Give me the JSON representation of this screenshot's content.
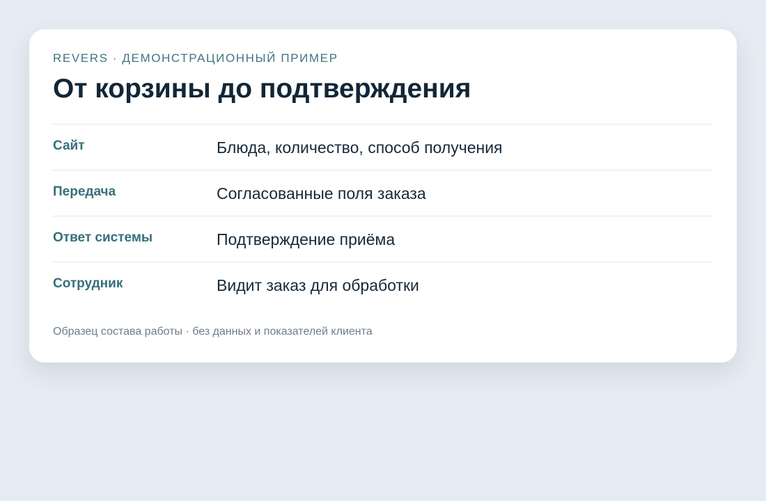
{
  "card": {
    "eyebrow": "REVERS · ДЕМОНСТРАЦИОННЫЙ ПРИМЕР",
    "title": "От корзины до подтверждения",
    "rows": [
      {
        "label": "Сайт",
        "value": "Блюда, количество, способ получения"
      },
      {
        "label": "Передача",
        "value": "Согласованные поля заказа"
      },
      {
        "label": "Ответ системы",
        "value": "Подтверждение приёма"
      },
      {
        "label": "Сотрудник",
        "value": "Видит заказ для обработки"
      }
    ],
    "footnote": "Образец состава работы · без данных и показателей клиента"
  },
  "colors": {
    "page_background": "#e6ecf3",
    "card_background": "#ffffff",
    "accent": "#356f7b",
    "title": "#132636",
    "muted": "#6f7c88"
  }
}
